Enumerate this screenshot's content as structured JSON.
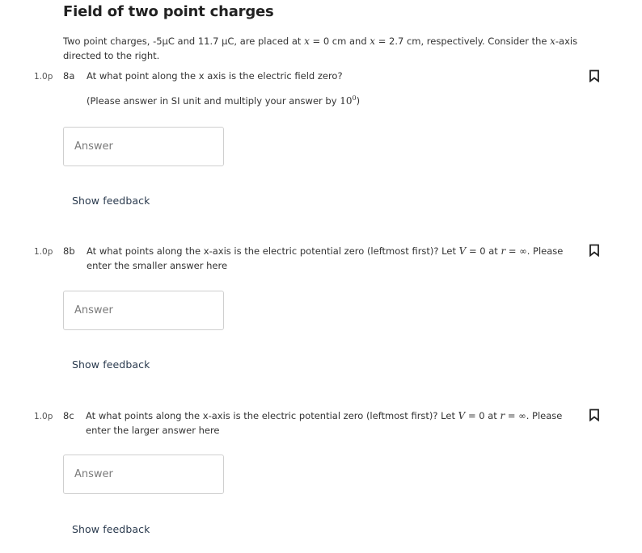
{
  "title": "Field of two point charges",
  "intro": {
    "part1": "Two point charges, -5µC and 11.7 µC, are placed at ",
    "var_x1": "x",
    "part2": " = 0 cm and ",
    "var_x2": "x",
    "part3": " = 2.7 cm, respectively. Consider the ",
    "var_x3": "x",
    "part4": "-axis directed to the right."
  },
  "questions": [
    {
      "points": "1.0p",
      "number": "8a",
      "text": "At what point along the x axis is the electric field zero?",
      "hint_prefix": "(Please answer in SI unit and multiply your answer by ",
      "hint_base": "10",
      "hint_exp": "0",
      "hint_suffix": ")",
      "answer_placeholder": "Answer",
      "answer_value": "",
      "feedback_label": "Show feedback"
    },
    {
      "points": "1.0p",
      "number": "8b",
      "text_a": "At what points along the x-axis is the electric potential zero (leftmost first)? Let ",
      "var_V": "V",
      "text_b": " = 0 at ",
      "var_r": "r",
      "text_c": " = ∞. Please enter the smaller answer here",
      "answer_placeholder": "Answer",
      "answer_value": "",
      "feedback_label": "Show feedback"
    },
    {
      "points": "1.0p",
      "number": "8c",
      "text_a": "At what points along the x-axis is the electric potential zero (leftmost first)? Let ",
      "var_V": "V",
      "text_b": " = 0 at ",
      "var_r": "r",
      "text_c": " = ∞. Please enter the larger answer here",
      "answer_placeholder": "Answer",
      "answer_value": "",
      "feedback_label": "Show feedback"
    }
  ],
  "icons": {
    "bookmark": "bookmark-icon"
  }
}
